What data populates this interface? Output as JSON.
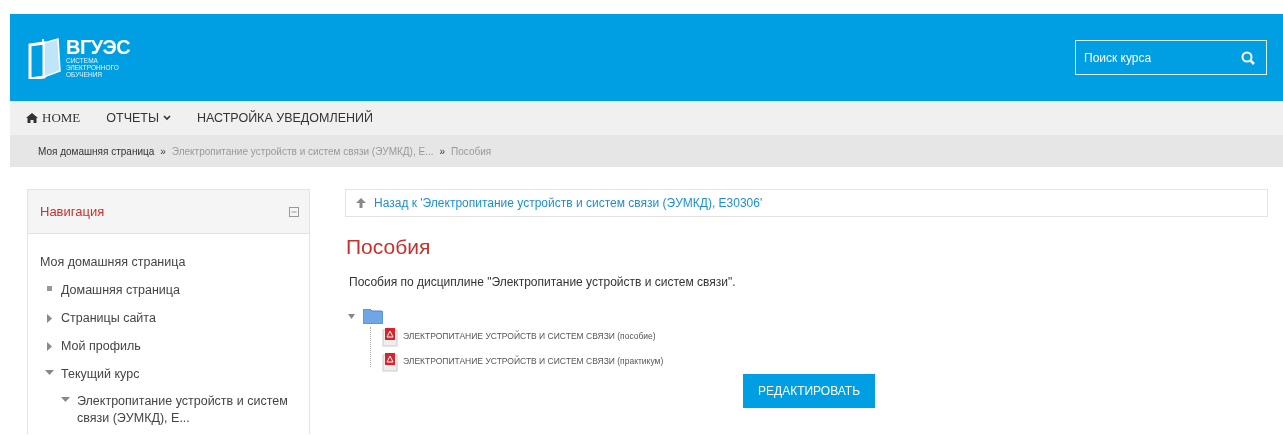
{
  "logo": {
    "title": "ВГУЭС",
    "subtitle": [
      "СИСТЕМА",
      "ЭЛЕКТРОННОГО",
      "ОБУЧЕНИЯ"
    ]
  },
  "search": {
    "placeholder": "Поиск курса"
  },
  "menu": [
    {
      "label": "HOME",
      "kind": "home"
    },
    {
      "label": "ОТЧЕТЫ",
      "kind": "dropdown"
    },
    {
      "label": "НАСТРОЙКА УВЕДОМЛЕНИЙ",
      "kind": "plain"
    }
  ],
  "breadcrumb": {
    "separator": "»",
    "items": [
      "Моя домашняя страница",
      "Электропитание устройств и систем связи (ЭУМКД), Е...",
      "Пособия"
    ]
  },
  "navigation": {
    "title": "Навигация",
    "items": [
      {
        "label": "Моя домашняя страница",
        "children": [
          {
            "label": "Домашняя страница",
            "kind": "leaf"
          },
          {
            "label": "Страницы сайта",
            "kind": "branch",
            "expanded": false
          },
          {
            "label": "Мой профиль",
            "kind": "branch",
            "expanded": false
          },
          {
            "label": "Текущий курс",
            "kind": "branch",
            "expanded": true,
            "children": [
              {
                "label": "Электропитание устройств и систем связи (ЭУМКД), Е...",
                "kind": "branch",
                "expanded": true
              }
            ]
          }
        ]
      }
    ]
  },
  "back_link": "Назад к 'Электропитание устройств и систем связи (ЭУМКД), Е30306'",
  "heading": "Пособия",
  "description": "Пособия по дисциплине \"Электропитание устройств и систем связи\".",
  "folder": {
    "expanded": true,
    "files": [
      {
        "name": "ЭЛЕКТРОПИТАНИЕ УСТРОЙСТВ И СИСТЕМ СВЯЗИ (пособие)"
      },
      {
        "name": "ЭЛЕКТРОПИТАНИЕ УСТРОЙСТВ И СИСТЕМ СВЯЗИ (практикум)"
      }
    ]
  },
  "edit_button": "РЕДАКТИРОВАТЬ"
}
